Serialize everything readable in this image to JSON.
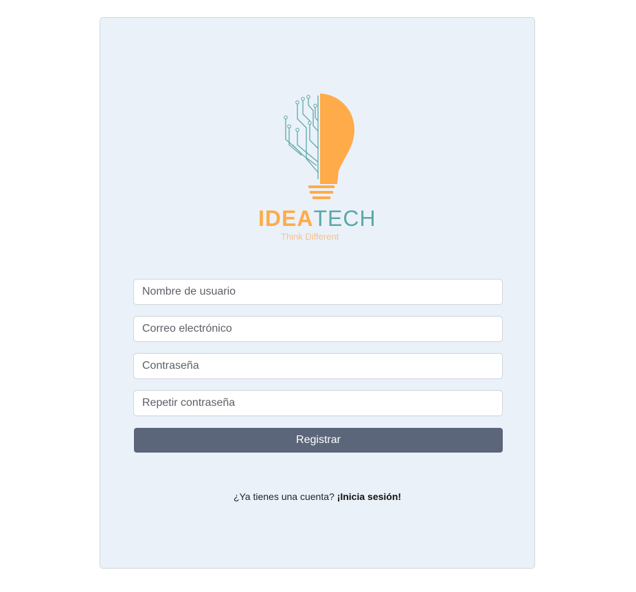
{
  "brand": {
    "name_part1": "IDEA",
    "name_part2": "TECH",
    "tagline": "Think Different",
    "colors": {
      "orange": "#ffab49",
      "teal": "#5aa8a8",
      "tagline": "#f5c28a"
    }
  },
  "form": {
    "username_placeholder": "Nombre de usuario",
    "email_placeholder": "Correo electrónico",
    "password_placeholder": "Contraseña",
    "repeat_password_placeholder": "Repetir contraseña",
    "submit_label": "Registrar",
    "submit_color": "#5c667a"
  },
  "footer": {
    "prompt": "¿Ya tienes una cuenta?",
    "login_link": "¡Inicia sesión!"
  }
}
